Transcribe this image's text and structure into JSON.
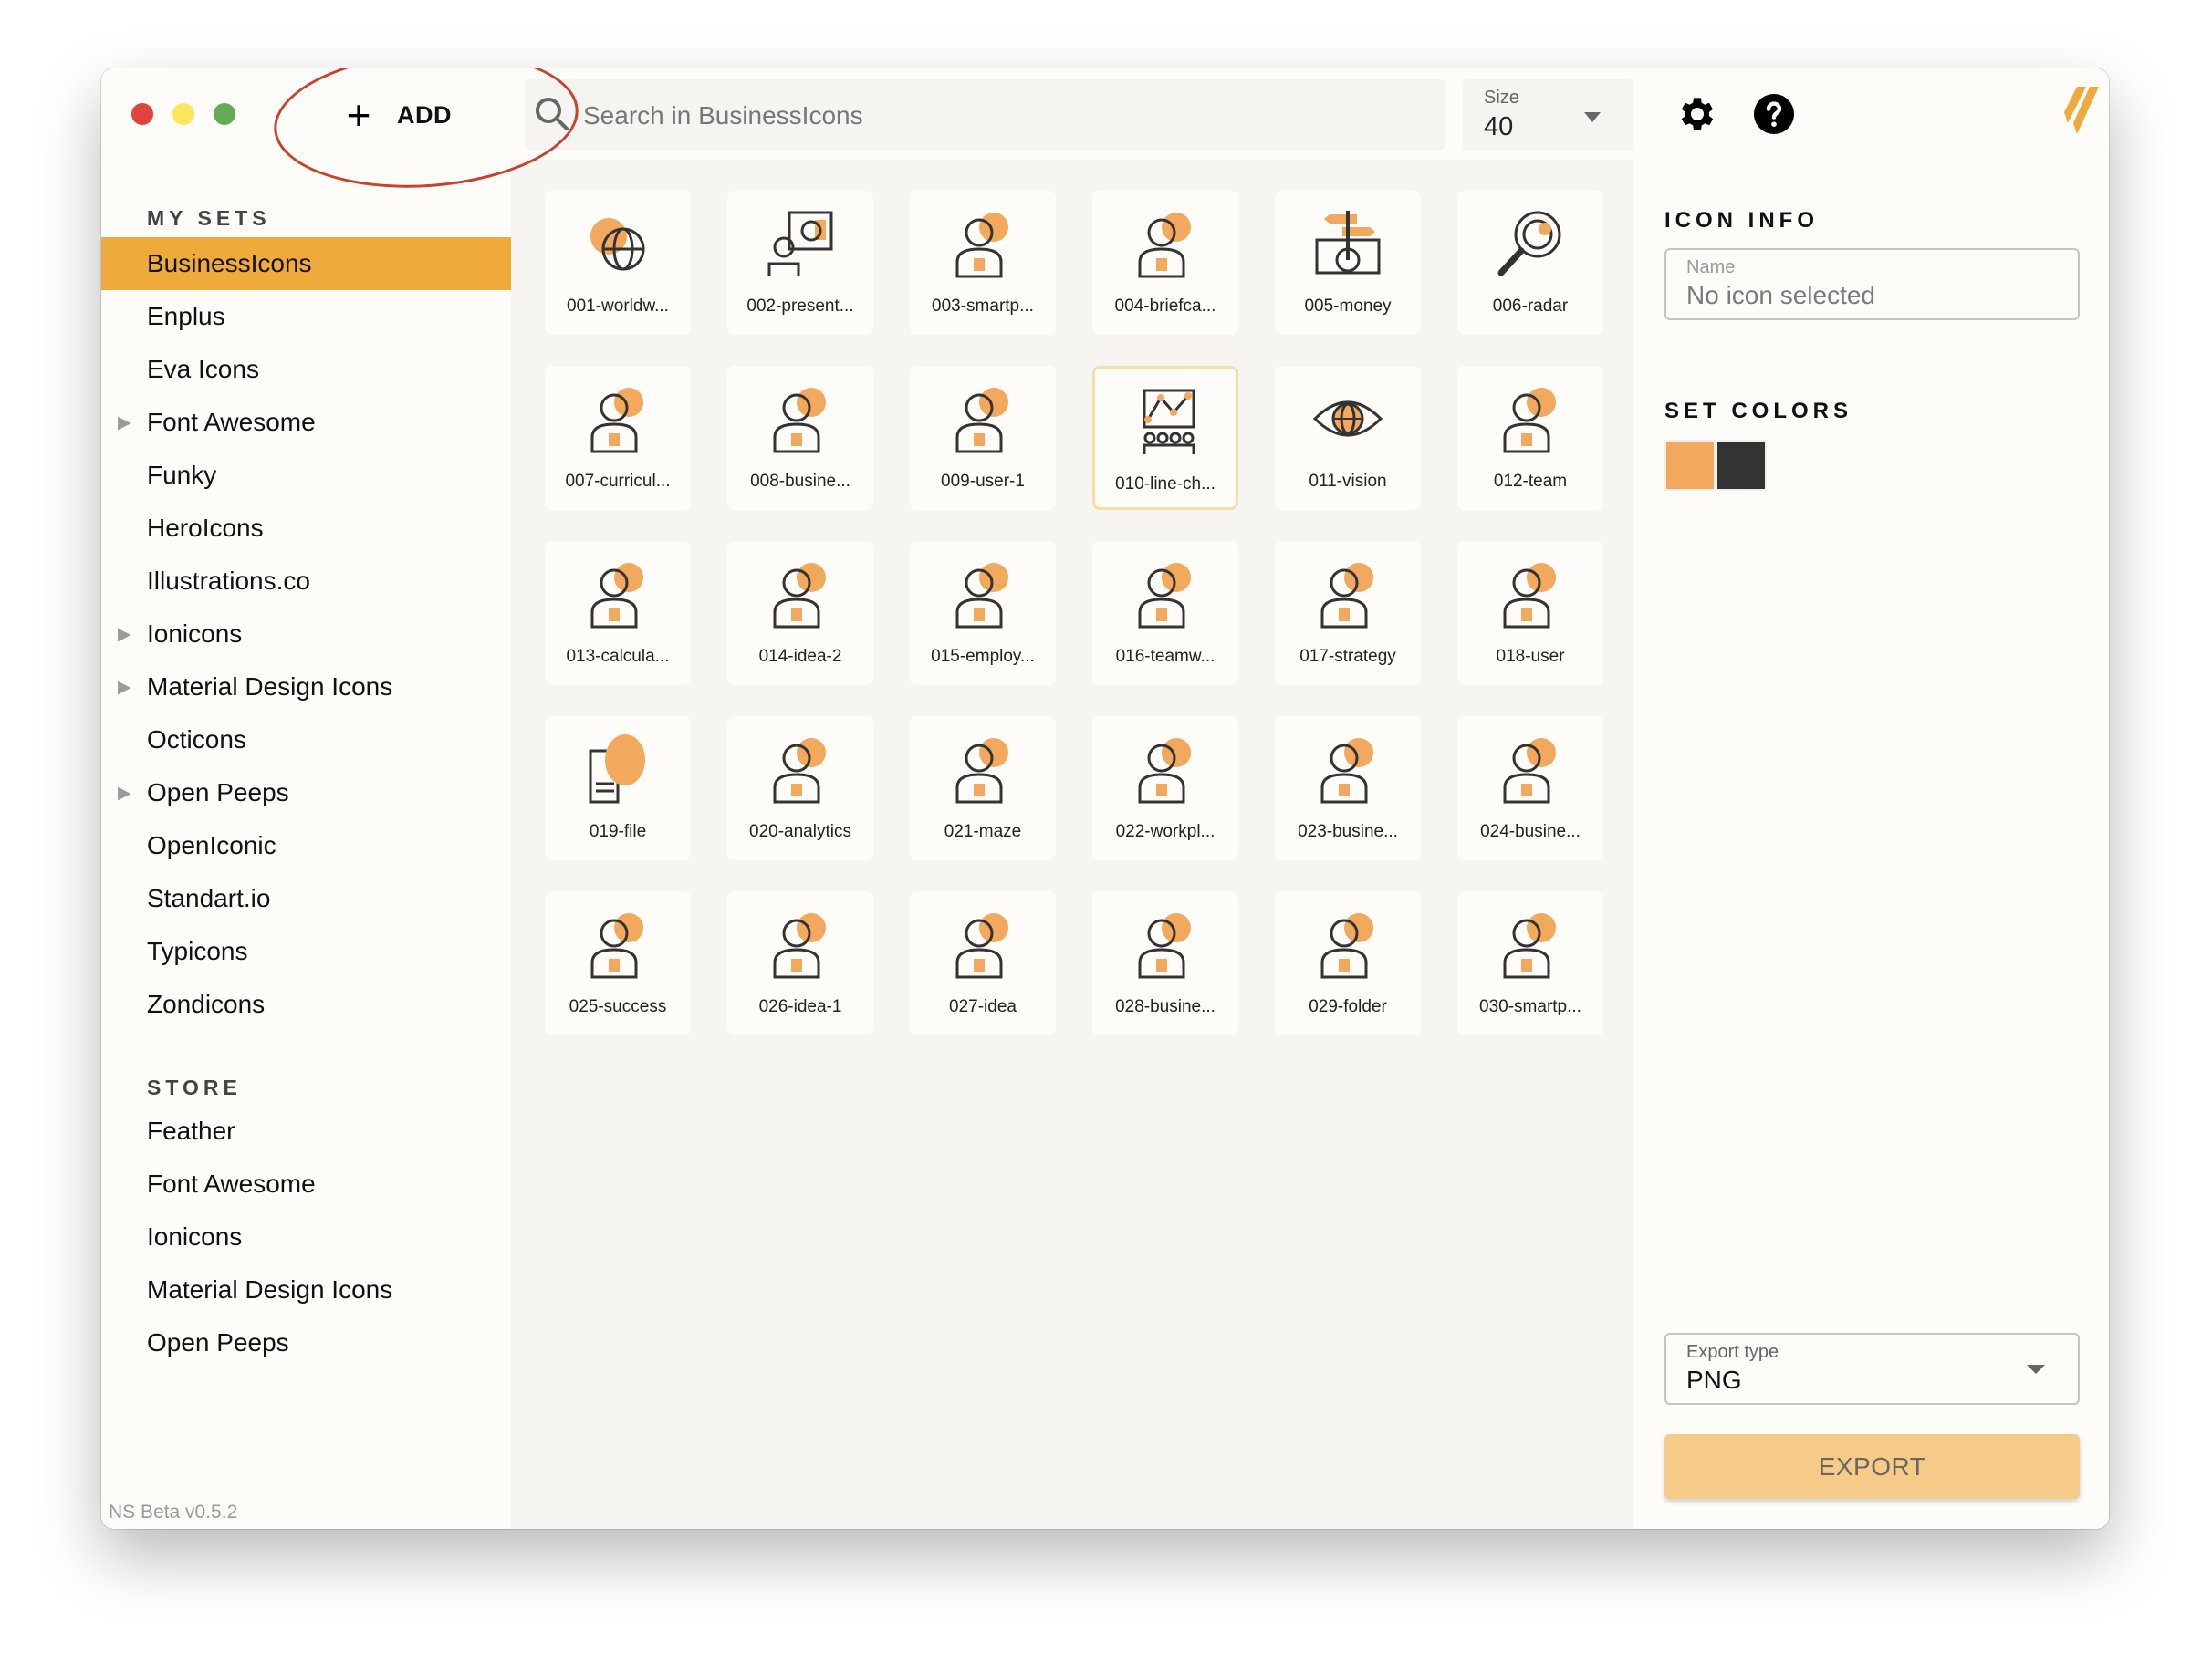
{
  "window": {
    "controls": [
      "close",
      "minimize",
      "maximize"
    ]
  },
  "toolbar": {
    "add_label": "ADD",
    "search_placeholder": "Search in BusinessIcons",
    "search_value": "",
    "size_label": "Size",
    "size_value": "40",
    "settings_icon": "gear-icon",
    "help_icon": "help-icon"
  },
  "sidebar": {
    "my_sets_label": "MY SETS",
    "my_sets": [
      {
        "label": "BusinessIcons",
        "active": true,
        "expandable": false
      },
      {
        "label": "Enplus",
        "active": false,
        "expandable": false
      },
      {
        "label": "Eva Icons",
        "active": false,
        "expandable": false
      },
      {
        "label": "Font Awesome",
        "active": false,
        "expandable": true
      },
      {
        "label": "Funky",
        "active": false,
        "expandable": false
      },
      {
        "label": "HeroIcons",
        "active": false,
        "expandable": false
      },
      {
        "label": "Illustrations.co",
        "active": false,
        "expandable": false
      },
      {
        "label": "Ionicons",
        "active": false,
        "expandable": true
      },
      {
        "label": "Material Design Icons",
        "active": false,
        "expandable": true
      },
      {
        "label": "Octicons",
        "active": false,
        "expandable": false
      },
      {
        "label": "Open Peeps",
        "active": false,
        "expandable": true
      },
      {
        "label": "OpenIconic",
        "active": false,
        "expandable": false
      },
      {
        "label": "Standart.io",
        "active": false,
        "expandable": false
      },
      {
        "label": "Typicons",
        "active": false,
        "expandable": false
      },
      {
        "label": "Zondicons",
        "active": false,
        "expandable": false
      }
    ],
    "store_label": "STORE",
    "store": [
      {
        "label": "Feather"
      },
      {
        "label": "Font Awesome"
      },
      {
        "label": "Ionicons"
      },
      {
        "label": "Material Design Icons"
      },
      {
        "label": "Open Peeps"
      }
    ],
    "version": "NS Beta v0.5.2"
  },
  "icons": [
    {
      "name": "001-worldw...",
      "glyph": "globe-gear"
    },
    {
      "name": "002-present...",
      "glyph": "presentation"
    },
    {
      "name": "003-smartp...",
      "glyph": "smartphone-team"
    },
    {
      "name": "004-briefca...",
      "glyph": "briefcase-gear"
    },
    {
      "name": "005-money",
      "glyph": "money-signpost"
    },
    {
      "name": "006-radar",
      "glyph": "radar-magnifier"
    },
    {
      "name": "007-curricul...",
      "glyph": "curriculum"
    },
    {
      "name": "008-busine...",
      "glyph": "businessman-search"
    },
    {
      "name": "009-user-1",
      "glyph": "user-nodes"
    },
    {
      "name": "010-line-ch...",
      "glyph": "line-chart",
      "selected": true
    },
    {
      "name": "011-vision",
      "glyph": "eye-globe"
    },
    {
      "name": "012-team",
      "glyph": "team"
    },
    {
      "name": "013-calcula...",
      "glyph": "calculator"
    },
    {
      "name": "014-idea-2",
      "glyph": "idea-people"
    },
    {
      "name": "015-employ...",
      "glyph": "employee"
    },
    {
      "name": "016-teamw...",
      "glyph": "teamwork"
    },
    {
      "name": "017-strategy",
      "glyph": "strategy"
    },
    {
      "name": "018-user",
      "glyph": "user-globe"
    },
    {
      "name": "019-file",
      "glyph": "file"
    },
    {
      "name": "020-analytics",
      "glyph": "analytics"
    },
    {
      "name": "021-maze",
      "glyph": "maze"
    },
    {
      "name": "022-workpl...",
      "glyph": "workplace"
    },
    {
      "name": "023-busine...",
      "glyph": "business-target"
    },
    {
      "name": "024-busine...",
      "glyph": "businesswoman"
    },
    {
      "name": "025-success",
      "glyph": "success"
    },
    {
      "name": "026-idea-1",
      "glyph": "idea-bulb-dollar"
    },
    {
      "name": "027-idea",
      "glyph": "idea-gear"
    },
    {
      "name": "028-busine...",
      "glyph": "business-growth"
    },
    {
      "name": "029-folder",
      "glyph": "folder"
    },
    {
      "name": "030-smartp...",
      "glyph": "smartphone-dollar"
    }
  ],
  "icon_info": {
    "title": "ICON INFO",
    "name_label": "Name",
    "name_value": "No icon selected"
  },
  "set_colors": {
    "title": "SET COLORS",
    "colors": [
      "#f2a95e",
      "#333333"
    ]
  },
  "export": {
    "type_label": "Export type",
    "type_value": "PNG",
    "button_label": "EXPORT"
  },
  "colors": {
    "accent": "#efaa3c",
    "icon_primary": "#f2a95e",
    "icon_stroke": "#333333",
    "annotation": "#c9402d"
  }
}
